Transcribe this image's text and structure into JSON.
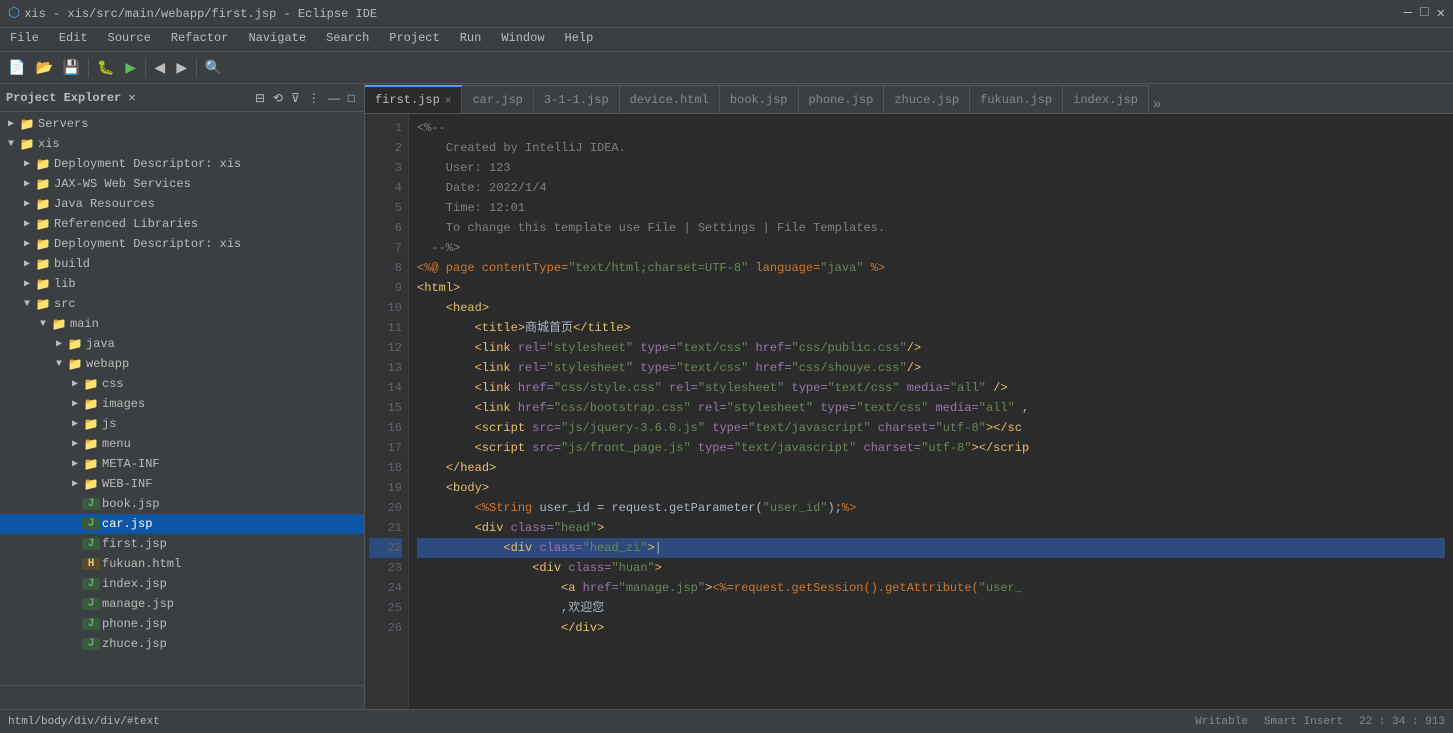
{
  "titleBar": {
    "title": "xis - xis/src/main/webapp/first.jsp - Eclipse IDE",
    "controls": [
      "—",
      "□",
      "✕"
    ]
  },
  "menuBar": {
    "items": [
      "File",
      "Edit",
      "Source",
      "Refactor",
      "Navigate",
      "Search",
      "Project",
      "Run",
      "Window",
      "Help"
    ]
  },
  "sidebar": {
    "title": "Project Explorer ✕",
    "tree": [
      {
        "id": "servers",
        "label": "Servers",
        "indent": 0,
        "type": "folder",
        "arrow": "▶"
      },
      {
        "id": "xis",
        "label": "xis",
        "indent": 0,
        "type": "folder",
        "arrow": "▼"
      },
      {
        "id": "deployment",
        "label": "Deployment Descriptor: xis",
        "indent": 1,
        "type": "folder",
        "arrow": "▶"
      },
      {
        "id": "jaxws",
        "label": "JAX-WS Web Services",
        "indent": 1,
        "type": "folder",
        "arrow": "▶"
      },
      {
        "id": "java-res",
        "label": "Java Resources",
        "indent": 1,
        "type": "folder",
        "arrow": "▶"
      },
      {
        "id": "ref-libs",
        "label": "Referenced Libraries",
        "indent": 1,
        "type": "folder",
        "arrow": "▶"
      },
      {
        "id": "deployment2",
        "label": "Deployment Descriptor: xis",
        "indent": 1,
        "type": "folder",
        "arrow": "▶"
      },
      {
        "id": "build",
        "label": "build",
        "indent": 1,
        "type": "folder",
        "arrow": "▶"
      },
      {
        "id": "lib",
        "label": "lib",
        "indent": 1,
        "type": "folder",
        "arrow": "▶"
      },
      {
        "id": "src",
        "label": "src",
        "indent": 1,
        "type": "folder",
        "arrow": "▼"
      },
      {
        "id": "main",
        "label": "main",
        "indent": 2,
        "type": "folder",
        "arrow": "▼"
      },
      {
        "id": "java",
        "label": "java",
        "indent": 3,
        "type": "folder",
        "arrow": "▶"
      },
      {
        "id": "webapp",
        "label": "webapp",
        "indent": 3,
        "type": "folder",
        "arrow": "▼"
      },
      {
        "id": "css",
        "label": "css",
        "indent": 4,
        "type": "folder",
        "arrow": "▶"
      },
      {
        "id": "images",
        "label": "images",
        "indent": 4,
        "type": "folder",
        "arrow": "▶"
      },
      {
        "id": "js",
        "label": "js",
        "indent": 4,
        "type": "folder",
        "arrow": "▶"
      },
      {
        "id": "menu",
        "label": "menu",
        "indent": 4,
        "type": "folder",
        "arrow": "▶"
      },
      {
        "id": "meta-inf",
        "label": "META-INF",
        "indent": 4,
        "type": "folder",
        "arrow": "▶"
      },
      {
        "id": "web-inf",
        "label": "WEB-INF",
        "indent": 4,
        "type": "folder",
        "arrow": "▶"
      },
      {
        "id": "book-jsp",
        "label": "book.jsp",
        "indent": 4,
        "type": "jsp",
        "arrow": ""
      },
      {
        "id": "car-jsp",
        "label": "car.jsp",
        "indent": 4,
        "type": "jsp",
        "arrow": "",
        "selected": true
      },
      {
        "id": "first-jsp",
        "label": "first.jsp",
        "indent": 4,
        "type": "jsp",
        "arrow": ""
      },
      {
        "id": "fukuan-html",
        "label": "fukuan.html",
        "indent": 4,
        "type": "html",
        "arrow": ""
      },
      {
        "id": "index-jsp",
        "label": "index.jsp",
        "indent": 4,
        "type": "jsp",
        "arrow": ""
      },
      {
        "id": "manage-jsp",
        "label": "manage.jsp",
        "indent": 4,
        "type": "jsp",
        "arrow": ""
      },
      {
        "id": "phone-jsp",
        "label": "phone.jsp",
        "indent": 4,
        "type": "jsp",
        "arrow": ""
      },
      {
        "id": "zhuce-jsp",
        "label": "zhuce.jsp",
        "indent": 4,
        "type": "jsp",
        "arrow": ""
      }
    ]
  },
  "tabs": [
    {
      "id": "first-jsp",
      "label": "first.jsp",
      "active": true,
      "closable": true
    },
    {
      "id": "car-jsp",
      "label": "car.jsp",
      "active": false,
      "closable": false
    },
    {
      "id": "3-1-1-jsp",
      "label": "3-1-1.jsp",
      "active": false,
      "closable": false
    },
    {
      "id": "device-html",
      "label": "device.html",
      "active": false,
      "closable": false
    },
    {
      "id": "book-jsp",
      "label": "book.jsp",
      "active": false,
      "closable": false
    },
    {
      "id": "phone-jsp",
      "label": "phone.jsp",
      "active": false,
      "closable": false
    },
    {
      "id": "zhuce-jsp",
      "label": "zhuce.jsp",
      "active": false,
      "closable": false
    },
    {
      "id": "fukuan-jsp",
      "label": "fukuan.jsp",
      "active": false,
      "closable": false
    },
    {
      "id": "index-jsp",
      "label": "index.jsp",
      "active": false,
      "closable": false
    }
  ],
  "code": {
    "lines": [
      {
        "num": "1",
        "content": "<%--",
        "highlight": false
      },
      {
        "num": "2",
        "content": "    Created by IntelliJ IDEA.",
        "highlight": false
      },
      {
        "num": "3",
        "content": "    User: 123",
        "highlight": false
      },
      {
        "num": "4",
        "content": "    Date: 2022/1/4",
        "highlight": false
      },
      {
        "num": "5",
        "content": "    Time: 12:01",
        "highlight": false
      },
      {
        "num": "6",
        "content": "    To change this template use File | Settings | File Templates.",
        "highlight": false
      },
      {
        "num": "7",
        "content": "  --%>",
        "highlight": false
      },
      {
        "num": "8",
        "content": "<%@ page contentType=\"text/html;charset=UTF-8\" language=\"java\" %>",
        "highlight": false
      },
      {
        "num": "9",
        "content": "<html>",
        "highlight": false
      },
      {
        "num": "10",
        "content": "    <head>",
        "highlight": false
      },
      {
        "num": "11",
        "content": "        <title>商城首页</title>",
        "highlight": false
      },
      {
        "num": "12",
        "content": "        <link rel=\"stylesheet\" type=\"text/css\" href=\"css/public.css\"/>",
        "highlight": false
      },
      {
        "num": "13",
        "content": "        <link rel=\"stylesheet\" type=\"text/css\" href=\"css/shouye.css\"/>",
        "highlight": false
      },
      {
        "num": "14",
        "content": "        <link href=\"css/style.css\" rel=\"stylesheet\" type=\"text/css\" media=\"all\" />",
        "highlight": false
      },
      {
        "num": "15",
        "content": "        <link href=\"css/bootstrap.css\" rel=\"stylesheet\" type=\"text/css\" media=\"all\" ,",
        "highlight": false
      },
      {
        "num": "16",
        "content": "        <script src=\"js/jquery-3.6.0.js\" type=\"text/javascript\" charset=\"utf-8\"></sc",
        "highlight": false
      },
      {
        "num": "17",
        "content": "        <script src=\"js/front_page.js\" type=\"text/javascript\" charset=\"utf-8\"></scrip",
        "highlight": false
      },
      {
        "num": "18",
        "content": "    </head>",
        "highlight": false
      },
      {
        "num": "19",
        "content": "    <body>",
        "highlight": false
      },
      {
        "num": "20",
        "content": "        <%String user_id = request.getParameter(\"user_id\");%>",
        "highlight": false
      },
      {
        "num": "21",
        "content": "        <div class=\"head\">",
        "highlight": false
      },
      {
        "num": "22",
        "content": "            <div class=\"head_zi\">|",
        "highlight": true
      },
      {
        "num": "23",
        "content": "                <div class=\"huan\">",
        "highlight": false
      },
      {
        "num": "24",
        "content": "                    <a href=\"manage.jsp\"><%=request.getSession().getAttribute(\"user_",
        "highlight": false
      },
      {
        "num": "25",
        "content": "                    ,欢迎您",
        "highlight": false
      },
      {
        "num": "26",
        "content": "                    </div>",
        "highlight": false
      }
    ]
  },
  "statusBar": {
    "left": "html/body/div/div/#text",
    "writable": "Writable",
    "insertMode": "Smart Insert",
    "position": "22 : 34 : 913"
  }
}
